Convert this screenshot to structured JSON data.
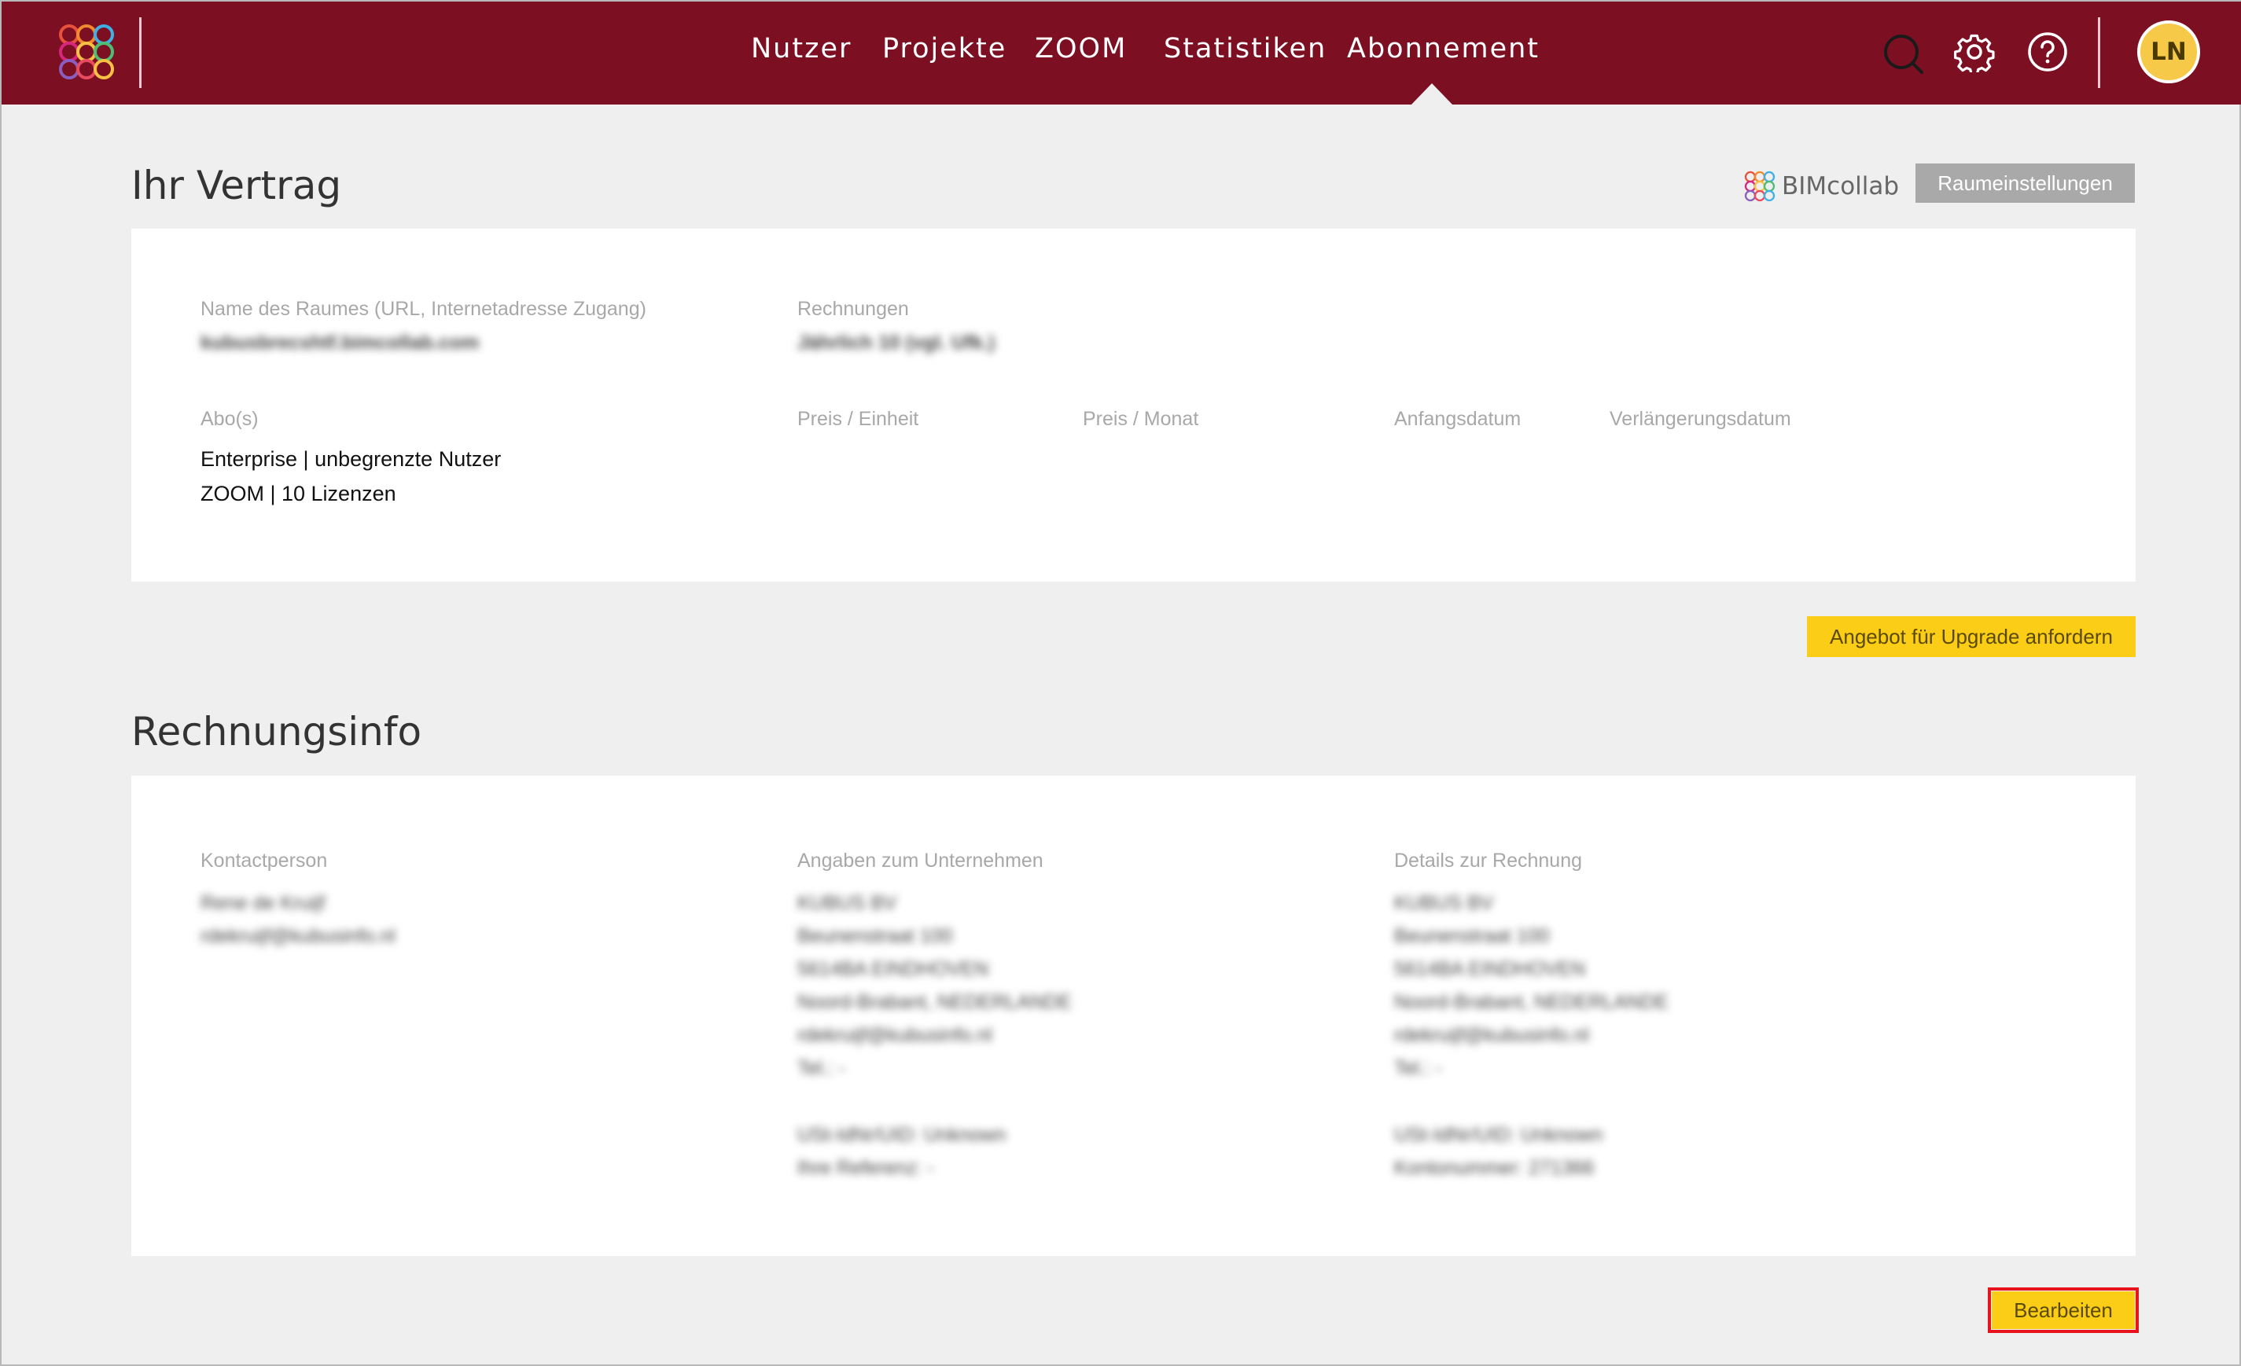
{
  "nav": {
    "items": [
      {
        "label": "Nutzer"
      },
      {
        "label": "Projekte"
      },
      {
        "label": "ZOOM"
      },
      {
        "label": "Statistiken"
      },
      {
        "label": "Abonnement",
        "active": true
      }
    ]
  },
  "toolbar": {
    "icons": [
      "search-icon",
      "gear-icon",
      "help-icon"
    ],
    "avatar_initials": "LN"
  },
  "contract": {
    "title": "Ihr Vertrag",
    "brand_name": "BIMcollab",
    "room_settings_label": "Raumeinstellungen",
    "room_name_label": "Name des Raumes (URL, Internetadresse Zugang)",
    "room_name_value": "kubusbrecshtf.bimcollab.com",
    "invoices_label": "Rechnungen",
    "invoices_value": "Jährlich 10 (vgl. Ufk.)",
    "subs_label": "Abo(s)",
    "price_unit_label": "Preis / Einheit",
    "price_month_label": "Preis / Monat",
    "start_label": "Anfangsdatum",
    "renewal_label": "Verlängerungsdatum",
    "subscriptions": [
      "Enterprise | unbegrenzte Nutzer",
      "ZOOM | 10  Lizenzen"
    ],
    "upgrade_button": "Angebot für Upgrade anfordern"
  },
  "billing": {
    "title": "Rechnungsinfo",
    "contact_label": "Kontactperson",
    "contact_lines": [
      "Rene de Kruijf",
      "rdekruijf@kubusinfo.nl"
    ],
    "company_label": "Angaben zum Unternehmen",
    "company_lines": [
      "KUBUS BV",
      "Beunenstraat 100",
      "5614BA EINDHOVEN",
      "Noord-Brabant, NEDERLANDE",
      "rdekruijf@kubusinfo.nl",
      "Tel.: -",
      "",
      "USt-IdNr/UID: Unknown",
      "Ihre Referenz: -"
    ],
    "invoice_label": "Details zur Rechnung",
    "invoice_lines": [
      "KUBUS BV",
      "Beunenstraat 100",
      "5614BA EINDHOVEN",
      "Noord-Brabant, NEDERLANDE",
      "rdekruijf@kubusinfo.nl",
      "Tel.: -",
      "",
      "USt-IdNr/UID: Unknown",
      "Kontonummer: 271366"
    ],
    "edit_button": "Bearbeiten"
  },
  "colors": {
    "topbar": "#7d0f22",
    "accent_yellow": "#fbcd16",
    "highlight_red": "#e8141d",
    "avatar": "#f7c948"
  }
}
